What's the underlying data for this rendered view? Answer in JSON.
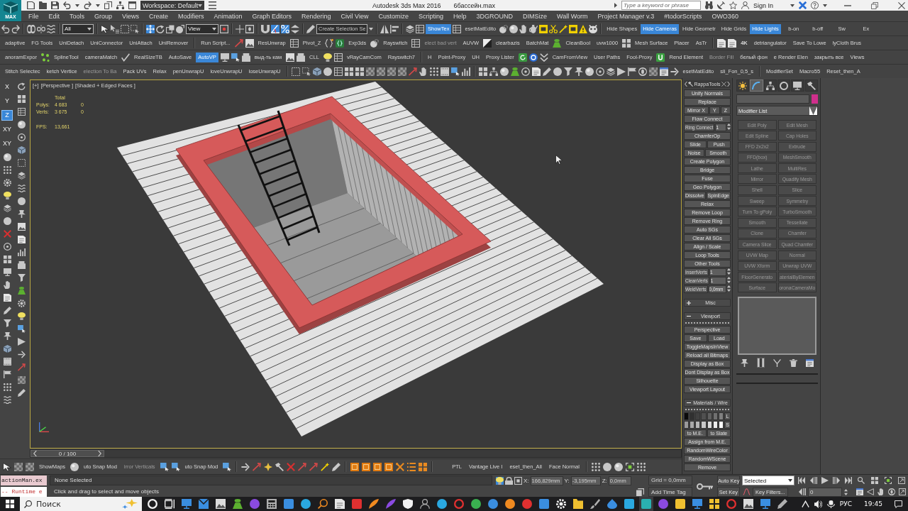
{
  "title_bar": {
    "logo": "MAX",
    "workspace": "Workspace: Default",
    "app_title": "Autodesk 3ds Max 2016",
    "file_name": "6бассейн.max",
    "search": {
      "placeholder": "Type a keyword or phrase"
    },
    "sign_in": "Sign In"
  },
  "menu_bar": [
    "File",
    "Edit",
    "Tools",
    "Group",
    "Views",
    "Create",
    "Modifiers",
    "Animation",
    "Graph Editors",
    "Rendering",
    "Civil View",
    "Customize",
    "Scripting",
    "Help",
    "3DGROUND",
    "DIMSize",
    "Wall Worm",
    "Project Manager v.3",
    "#todorScripts",
    "OWO360"
  ],
  "main_toolbar": {
    "selection_filter": "All",
    "transform_tools": [
      {
        "selected": true
      },
      {
        "selected": false
      },
      {
        "selected": false
      }
    ],
    "reference_coordinates": "View",
    "snaps": [
      {
        "on": false
      },
      {
        "on": true
      },
      {
        "on": true
      },
      {
        "on": false
      }
    ],
    "named_selection": "Create Selection Se",
    "buttons": [
      {
        "label": "ShowTex",
        "selected": true
      },
      {
        "label": "esetMatEdito",
        "selected": false
      }
    ],
    "display_toggles": [
      {
        "label": "Hide Shapes",
        "selected": false
      },
      {
        "label": "Hide Cameras",
        "selected": true
      },
      {
        "label": "Hide Geometr",
        "selected": false
      },
      {
        "label": "Hide Grids",
        "selected": false
      },
      {
        "label": "Hide Lights",
        "selected": true
      },
      {
        "label": "b-on",
        "selected": false
      },
      {
        "label": "b-off",
        "selected": false
      },
      {
        "label": "Sw",
        "selected": false
      },
      {
        "label": "Ex",
        "selected": false
      }
    ]
  },
  "script_toolbars": [
    [
      {
        "label": "adaptive",
        "selected": false,
        "disabled": false
      },
      {
        "label": "FG Tools",
        "selected": false,
        "disabled": false
      },
      {
        "label": "UniDetach",
        "selected": false,
        "disabled": false
      },
      {
        "label": "UniConnector",
        "selected": false,
        "disabled": false
      },
      {
        "label": "UniAttach",
        "selected": false,
        "disabled": false
      },
      {
        "label": "UniRemover",
        "selected": false,
        "disabled": false
      },
      {
        "label": "Run Script...",
        "selected": false,
        "disabled": false
      },
      {
        "label": "ResUnwrap",
        "selected": false,
        "disabled": false
      },
      {
        "label": "Pivot_Z",
        "selected": false,
        "disabled": false
      },
      {
        "label": "Exp3ds",
        "selected": false,
        "disabled": false
      },
      {
        "label": "Rayswitch",
        "selected": false,
        "disabled": false
      },
      {
        "label": "elect bad vert",
        "selected": false,
        "disabled": true
      },
      {
        "label": "AUVW",
        "selected": false,
        "disabled": false
      },
      {
        "label": "clearbazis",
        "selected": false,
        "disabled": false
      },
      {
        "label": "BatchMat",
        "selected": false,
        "disabled": false
      },
      {
        "label": "CleanBool",
        "selected": false,
        "disabled": false
      },
      {
        "label": "uvw1000",
        "selected": false,
        "disabled": false
      },
      {
        "label": "Mesh Surface",
        "selected": false,
        "disabled": false
      },
      {
        "label": "Placer",
        "selected": false,
        "disabled": false
      },
      {
        "label": "AsTr",
        "selected": false,
        "disabled": false
      },
      {
        "label": "4K",
        "selected": false,
        "disabled": false
      },
      {
        "label": "detriangulator",
        "selected": false,
        "disabled": false
      },
      {
        "label": "Save To Lowe",
        "selected": false,
        "disabled": false
      },
      {
        "label": "lyCloth Brus",
        "selected": false,
        "disabled": false
      }
    ],
    [
      {
        "label": "anoramExpor",
        "selected": false,
        "disabled": false
      },
      {
        "label": "SplineTool",
        "selected": false,
        "disabled": false
      },
      {
        "label": "cameraMatch",
        "selected": false,
        "disabled": false
      },
      {
        "label": "RealSizeTB",
        "selected": false,
        "disabled": false
      },
      {
        "label": "AutoSave",
        "selected": false,
        "disabled": false
      },
      {
        "label": "AutoVP",
        "selected": true,
        "disabled": false
      },
      {
        "label": "выд-ть кам",
        "selected": false,
        "disabled": false
      },
      {
        "label": "CLL",
        "selected": false,
        "disabled": false
      },
      {
        "label": "vRayCamCom",
        "selected": false,
        "disabled": false
      },
      {
        "label": "Rayswitch7",
        "selected": false,
        "disabled": false
      },
      {
        "label": "H",
        "selected": false,
        "disabled": false
      },
      {
        "label": "Point-Proxy",
        "selected": false,
        "disabled": false
      },
      {
        "label": "UH",
        "selected": false,
        "disabled": false
      },
      {
        "label": "Proxy Lister",
        "selected": false,
        "disabled": false
      },
      {
        "label": "CamFromView",
        "selected": false,
        "disabled": false
      },
      {
        "label": "User Paths",
        "selected": false,
        "disabled": false
      },
      {
        "label": "Fool-Proxy",
        "selected": false,
        "disabled": false
      },
      {
        "label": "Rend Element",
        "selected": false,
        "disabled": false
      },
      {
        "label": "Border Fill",
        "selected": false,
        "disabled": true
      },
      {
        "label": "белый фон",
        "selected": false,
        "disabled": false
      },
      {
        "label": "e Render Elen",
        "selected": false,
        "disabled": false
      },
      {
        "label": "закрыть все",
        "selected": false,
        "disabled": false
      },
      {
        "label": "Views",
        "selected": false,
        "disabled": false
      }
    ],
    [
      {
        "label": "Stitch Selectec",
        "selected": false,
        "disabled": false
      },
      {
        "label": "ketch Vertice",
        "selected": false,
        "disabled": false
      },
      {
        "label": "election To Ba",
        "selected": false,
        "disabled": true
      },
      {
        "label": "Pack UVs",
        "selected": false,
        "disabled": false
      },
      {
        "label": "Relax",
        "selected": false,
        "disabled": false
      },
      {
        "label": "penUnwrapU",
        "selected": false,
        "disabled": false
      },
      {
        "label": "loveUnwrapU",
        "selected": false,
        "disabled": false
      },
      {
        "label": "loseUnwrapU",
        "selected": false,
        "disabled": false
      },
      {
        "label": "esetMatEdito",
        "selected": false,
        "disabled": false
      },
      {
        "label": "sli_Fon_0,5_s",
        "selected": false,
        "disabled": false
      },
      {
        "label": "ModifierSet",
        "selected": false,
        "disabled": false
      },
      {
        "label": "Macro55",
        "selected": false,
        "disabled": false
      },
      {
        "label": "Reset_then_A",
        "selected": false,
        "disabled": false
      }
    ]
  ],
  "axis_constraints": [
    {
      "label": "X",
      "selected": false
    },
    {
      "label": "Y",
      "selected": false
    },
    {
      "label": "Z",
      "selected": true
    },
    {
      "label": "XY",
      "selected": false
    },
    {
      "label": "XY",
      "selected": false
    }
  ],
  "viewport": {
    "labels": [
      "[+]",
      "[Perspective ]",
      "[Shaded + Edged Faces ]"
    ],
    "stats": {
      "heading": "Total",
      "rows": [
        {
          "label": "Polys:",
          "total": "4 683",
          "selected": "0"
        },
        {
          "label": "Verts:",
          "total": "3 675",
          "selected": "0"
        }
      ],
      "fps_label": "FPS:",
      "fps": "13,661"
    }
  },
  "time_slider": {
    "label": "0 / 100",
    "level": 0
  },
  "bottom_toolbar": [
    {
      "label": "ShowMaps",
      "disabled": false
    },
    {
      "label": "uto Snap Mod",
      "disabled": false
    },
    {
      "label": "irror Verticals",
      "disabled": true
    },
    {
      "label": "uto Snap Mod",
      "disabled": false
    },
    {
      "label": "PTL",
      "disabled": false
    },
    {
      "label": "Vantage Live I",
      "disabled": false
    },
    {
      "label": "eset_then_All",
      "disabled": false
    },
    {
      "label": "Face Normal",
      "disabled": false
    }
  ],
  "rappa_tools": {
    "title": "RappaTools",
    "rows": [
      [
        {
          "kind": "button",
          "label": "Unify Normals"
        }
      ],
      [
        {
          "kind": "button",
          "label": "Replace"
        }
      ],
      [
        {
          "kind": "button",
          "label": "Mirror X"
        },
        {
          "kind": "button",
          "label": "Y"
        },
        {
          "kind": "button",
          "label": "Z"
        }
      ],
      [
        {
          "kind": "button",
          "label": "Flow Connect"
        }
      ],
      [
        {
          "kind": "spinner",
          "label": "Ring Connect",
          "value": "1"
        }
      ],
      [
        {
          "kind": "button",
          "label": "ChamferOp"
        }
      ],
      [
        {
          "kind": "button",
          "label": "Slide"
        },
        {
          "kind": "button",
          "label": "Push"
        }
      ],
      [
        {
          "kind": "button",
          "label": "Noise"
        },
        {
          "kind": "button",
          "label": "Smooth"
        }
      ],
      [
        {
          "kind": "button",
          "label": "Create Polygon"
        }
      ],
      [
        {
          "kind": "button",
          "label": "Bridge"
        }
      ],
      [
        {
          "kind": "button",
          "label": "Fuse"
        }
      ],
      [
        {
          "kind": "button",
          "label": "Geo Polygon"
        }
      ],
      [
        {
          "kind": "button",
          "label": "Dissolve"
        },
        {
          "kind": "button",
          "label": "SpinEdge"
        }
      ],
      [
        {
          "kind": "button",
          "label": "Relax"
        }
      ],
      [
        {
          "kind": "button",
          "label": "Remove Loop"
        }
      ],
      [
        {
          "kind": "button",
          "label": "Remove Ring"
        }
      ],
      [
        {
          "kind": "button",
          "label": "Auto SGs"
        }
      ],
      [
        {
          "kind": "button",
          "label": "Clear All SGs"
        }
      ],
      [
        {
          "kind": "button",
          "label": "Align / Scale"
        }
      ],
      [
        {
          "kind": "button",
          "label": "Loop Tools"
        }
      ],
      [
        {
          "kind": "button",
          "label": "Other Tools"
        }
      ],
      [
        {
          "kind": "spinner",
          "label": "InsertVerts",
          "value": "1"
        }
      ],
      [
        {
          "kind": "spinner",
          "label": "CleanVerts",
          "value": "1"
        }
      ],
      [
        {
          "kind": "spinner",
          "label": "WeldVerts",
          "value": "0,0mm"
        }
      ]
    ],
    "rollouts": [
      {
        "label": "Misc",
        "expanded": false
      },
      {
        "label": "Viewport",
        "expanded": true,
        "rows": [
          [
            {
              "kind": "button",
              "label": "Perspective"
            }
          ],
          [
            {
              "kind": "button",
              "label": "Save"
            },
            {
              "kind": "button",
              "label": "Load"
            }
          ],
          [
            {
              "kind": "button",
              "label": "ToggleMapsInView"
            }
          ],
          [
            {
              "kind": "button",
              "label": "Reload all Bitmaps"
            }
          ],
          [
            {
              "kind": "button",
              "label": "Display as Box"
            }
          ],
          [
            {
              "kind": "button",
              "label": "Dont Display as Box"
            }
          ],
          [
            {
              "kind": "button",
              "label": "Silhouette"
            }
          ],
          [
            {
              "kind": "button",
              "label": "Viewport Layout"
            }
          ]
        ]
      },
      {
        "label": "Materials / Wire",
        "expanded": true,
        "swatch_rows": [
          {
            "label": "L",
            "swatches": [
              {
                "color": "#0a0a0a"
              },
              {
                "color": "#303030"
              },
              {
                "color": "#404040"
              },
              {
                "color": "#505050"
              },
              {
                "color": "#606060"
              },
              {
                "color": "#707070"
              },
              {
                "color": "#808080"
              }
            ]
          },
          {
            "label": "S",
            "swatches": [
              {
                "color": "#9a9a9a"
              },
              {
                "color": "#a8a8a8"
              },
              {
                "color": "#b6b6b6"
              },
              {
                "color": "#c8c8c8"
              },
              {
                "color": "#dadada"
              },
              {
                "color": "#ececec"
              },
              {
                "color": "#fafafa"
              }
            ]
          }
        ],
        "rows": [
          [
            {
              "kind": "button",
              "label": "to M.E."
            },
            {
              "kind": "button",
              "label": "to Slate"
            }
          ],
          [
            {
              "kind": "button",
              "label": "Assign from M.E."
            }
          ],
          [
            {
              "kind": "button",
              "label": "RandomWireColor"
            }
          ],
          [
            {
              "kind": "button",
              "label": "RandomWScene"
            }
          ],
          [
            {
              "kind": "button",
              "label": "Remove"
            }
          ]
        ]
      }
    ]
  },
  "command_panel": {
    "tabs": [
      {
        "selected": false
      },
      {
        "selected": true
      },
      {
        "selected": false
      },
      {
        "selected": false
      },
      {
        "selected": false
      },
      {
        "selected": false
      }
    ],
    "modifier_list": "Modifier List",
    "modifier_buttons": {
      "disabled": true,
      "labels": [
        "Edit Poly",
        "Edit Mesh",
        "Edit Spline",
        "Cap Holes",
        "FFD 2x2x2",
        "Extrude",
        "FFD(box)",
        "MeshSmooth",
        "Lathe",
        "MultiRes",
        "Mirror",
        "Quadify Mesh",
        "Shell",
        "Slice",
        "Sweep",
        "Symmetry",
        "Turn To gPoly",
        "TurboSmooth",
        "Smooth",
        "Tessellate",
        "Clone",
        "Chamfer",
        "Camera Slice",
        "Quad Chamfer",
        "UVW Map",
        "Normal",
        "UVW Xform",
        "Unwrap UVW",
        "FloorGenerato",
        "aterialByElemen",
        "Surface",
        "oronaCameraMo"
      ]
    }
  },
  "status_bar": {
    "listener_input": "actionMan.ex",
    "listener_output": "-- Runtime e",
    "selection": "None Selected",
    "prompt": "Click and drag to select and move objects",
    "toggles": [
      {
        "on": true
      },
      {
        "on": false
      }
    ],
    "coordinates": [
      {
        "axis": "X:",
        "value": "166,829mm"
      },
      {
        "axis": "Y:",
        "value": "-3,195mm"
      },
      {
        "axis": "Z:",
        "value": "0,0mm"
      }
    ],
    "grid": "Grid = 0,0mm",
    "time_tag": "Add Time Tag",
    "auto_key": {
      "label": "Auto Key",
      "selected": false
    },
    "key_mode": "Selected",
    "set_key": "Set Key",
    "key_filters": "Key Filters...",
    "frame": "0"
  },
  "taskbar": {
    "search": {
      "placeholder": "Поиск"
    },
    "language": "РУС",
    "time": "19:45"
  }
}
